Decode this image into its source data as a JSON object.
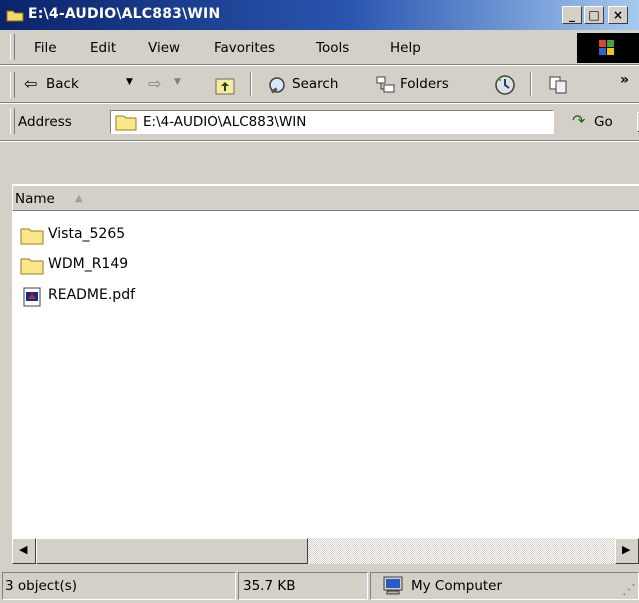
{
  "window": {
    "title": "E:\\4-AUDIO\\ALC883\\WIN",
    "controls": {
      "minimize": "_",
      "maximize": "□",
      "close": "×"
    }
  },
  "menu": {
    "items": [
      {
        "label": "File"
      },
      {
        "label": "Edit"
      },
      {
        "label": "View"
      },
      {
        "label": "Favorites"
      },
      {
        "label": "Tools"
      },
      {
        "label": "Help"
      }
    ]
  },
  "toolbar": {
    "back": "Back",
    "search": "Search",
    "folders": "Folders",
    "overflow": "»"
  },
  "address": {
    "label": "Address",
    "value": "E:\\4-AUDIO\\ALC883\\WIN",
    "go": "Go"
  },
  "list": {
    "column_name": "Name",
    "sort_indicator": "▲",
    "items": [
      {
        "name": "Vista_5265",
        "icon": "folder-icon"
      },
      {
        "name": "WDM_R149",
        "icon": "folder-icon"
      },
      {
        "name": "README.pdf",
        "icon": "pdf-file-icon"
      }
    ]
  },
  "status": {
    "objects": "3 object(s)",
    "size": "35.7 KB",
    "zone": "My Computer"
  },
  "colors": {
    "title_start": "#0a246a",
    "title_end": "#a6caf0",
    "chrome": "#d4d0c8",
    "folder": "#f8e88a"
  }
}
